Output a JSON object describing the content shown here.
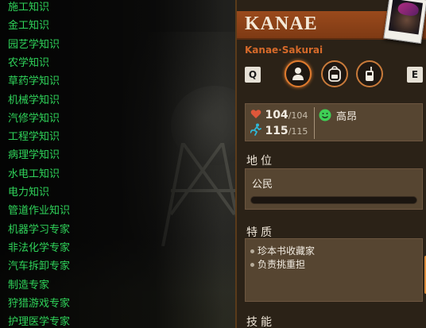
{
  "skill_list": {
    "items": [
      "施工知识",
      "金工知识",
      "园艺学知识",
      "农学知识",
      "草药学知识",
      "机械学知识",
      "汽修学知识",
      "工程学知识",
      "病理学知识",
      "水电工知识",
      "电力知识",
      "管道作业知识",
      "机器学习专家",
      "非法化学专家",
      "汽车拆卸专家",
      "制造专家",
      "狩猎游戏专家",
      "护理医学专家"
    ],
    "color": "#2fd45a"
  },
  "character": {
    "name": "KANAE",
    "full_name": "Kanae·Sakurai",
    "portrait_icon": "character-portrait"
  },
  "tabs": {
    "prev_key": "Q",
    "next_key": "E",
    "items": [
      {
        "icon": "person-icon",
        "active": true
      },
      {
        "icon": "backpack-icon",
        "active": false
      },
      {
        "icon": "radio-icon",
        "active": false
      }
    ]
  },
  "stats": {
    "health_value": "104",
    "health_max": "/104",
    "stamina_value": "115",
    "stamina_max": "/115",
    "mood": "高昂",
    "health_color": "#e0573a",
    "stamina_color": "#2fb8d8",
    "mood_color": "#3fcf55"
  },
  "status": {
    "title": "地位",
    "value": "公民",
    "progress": 0
  },
  "traits": {
    "title": "特质",
    "items": [
      "珍本书收藏家",
      "负责挑重担"
    ]
  },
  "skills_section": {
    "title": "技能"
  },
  "colors": {
    "accent": "#e07b2e",
    "header": "#8a4118",
    "panel_bg": "#2b2217"
  }
}
